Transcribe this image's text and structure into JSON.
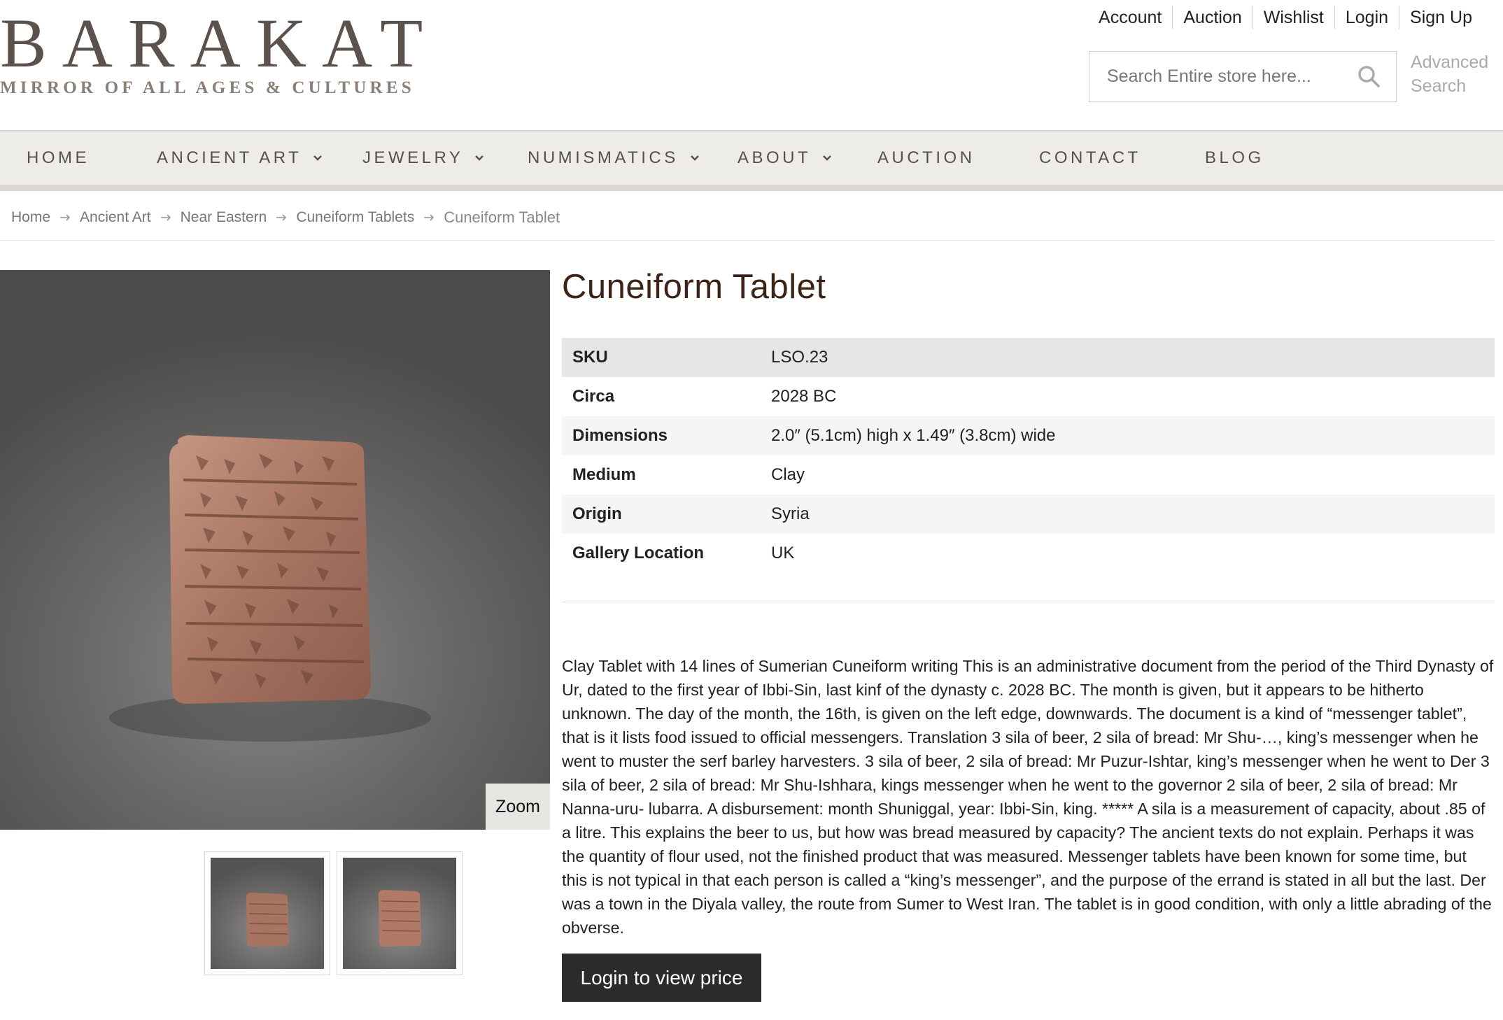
{
  "brand": {
    "name": "BARAKAT",
    "tagline": "MIRROR OF ALL AGES & CULTURES"
  },
  "top_links": [
    "Account",
    "Auction",
    "Wishlist",
    "Login",
    "Sign Up"
  ],
  "search": {
    "placeholder": "Search Entire store here...",
    "advanced_label": "Advanced Search"
  },
  "nav": [
    {
      "label": "HOME",
      "has_dropdown": false
    },
    {
      "label": "ANCIENT ART",
      "has_dropdown": true
    },
    {
      "label": "JEWELRY",
      "has_dropdown": true
    },
    {
      "label": "NUMISMATICS",
      "has_dropdown": true
    },
    {
      "label": "ABOUT",
      "has_dropdown": true
    },
    {
      "label": "AUCTION",
      "has_dropdown": false
    },
    {
      "label": "CONTACT",
      "has_dropdown": false
    },
    {
      "label": "BLOG",
      "has_dropdown": false
    }
  ],
  "breadcrumb": {
    "items": [
      "Home",
      "Ancient Art",
      "Near Eastern",
      "Cuneiform Tablets"
    ],
    "current": "Cuneiform Tablet"
  },
  "gallery": {
    "zoom_label": "Zoom",
    "thumbnail_count": 2
  },
  "product": {
    "title": "Cuneiform Tablet",
    "specs": [
      {
        "label": "SKU",
        "value": "LSO.23"
      },
      {
        "label": "Circa",
        "value": "2028 BC"
      },
      {
        "label": "Dimensions",
        "value": "2.0″ (5.1cm) high x 1.49″ (3.8cm) wide"
      },
      {
        "label": "Medium",
        "value": "Clay"
      },
      {
        "label": "Origin",
        "value": "Syria"
      },
      {
        "label": "Gallery Location",
        "value": "UK"
      }
    ],
    "description": "Clay Tablet with 14 lines of Sumerian Cuneiform writing This is an administrative document from the period of the Third Dynasty of Ur, dated to the first year of Ibbi-Sin, last kinf of the dynasty c. 2028 BC. The month is given, but it appears to be hitherto unknown. The day of the month, the 16th, is given on the left edge, downwards. The document is a kind of “messenger tablet”, that is it lists food issued to official messengers. Translation 3 sila of beer, 2 sila of bread: Mr Shu-…, king’s messenger when he went to muster the serf barley harvesters. 3 sila of beer, 2 sila of bread: Mr Puzur-Ishtar, king’s messenger when he went to Der 3 sila of beer, 2 sila of bread: Mr Shu-Ishhara, kings messenger when he went to the governor 2 sila of beer, 2 sila of bread: Mr Nanna-uru- lubarra. A disbursement: month Shuniggal, year: Ibbi-Sin, king. ***** A sila is a measurement of capacity, about .85 of a litre. This explains the beer to us, but how was bread measured by capacity? The ancient texts do not explain. Perhaps it was the quantity of flour used, not the finished product that was measured. Messenger tablets have been known for some time, but this is not typical in that each person is called a “king’s messenger”, and the purpose of the errand is stated in all but the last. Der was a town in the Diyala valley, the route from Sumer to West Iran. The tablet is in good condition, with only a little abrading of the obverse.",
    "cta_label": "Login to view price"
  },
  "colors": {
    "nav_bg": "#eeece8",
    "title": "#3b2416",
    "button_bg": "#2b2b2b"
  }
}
